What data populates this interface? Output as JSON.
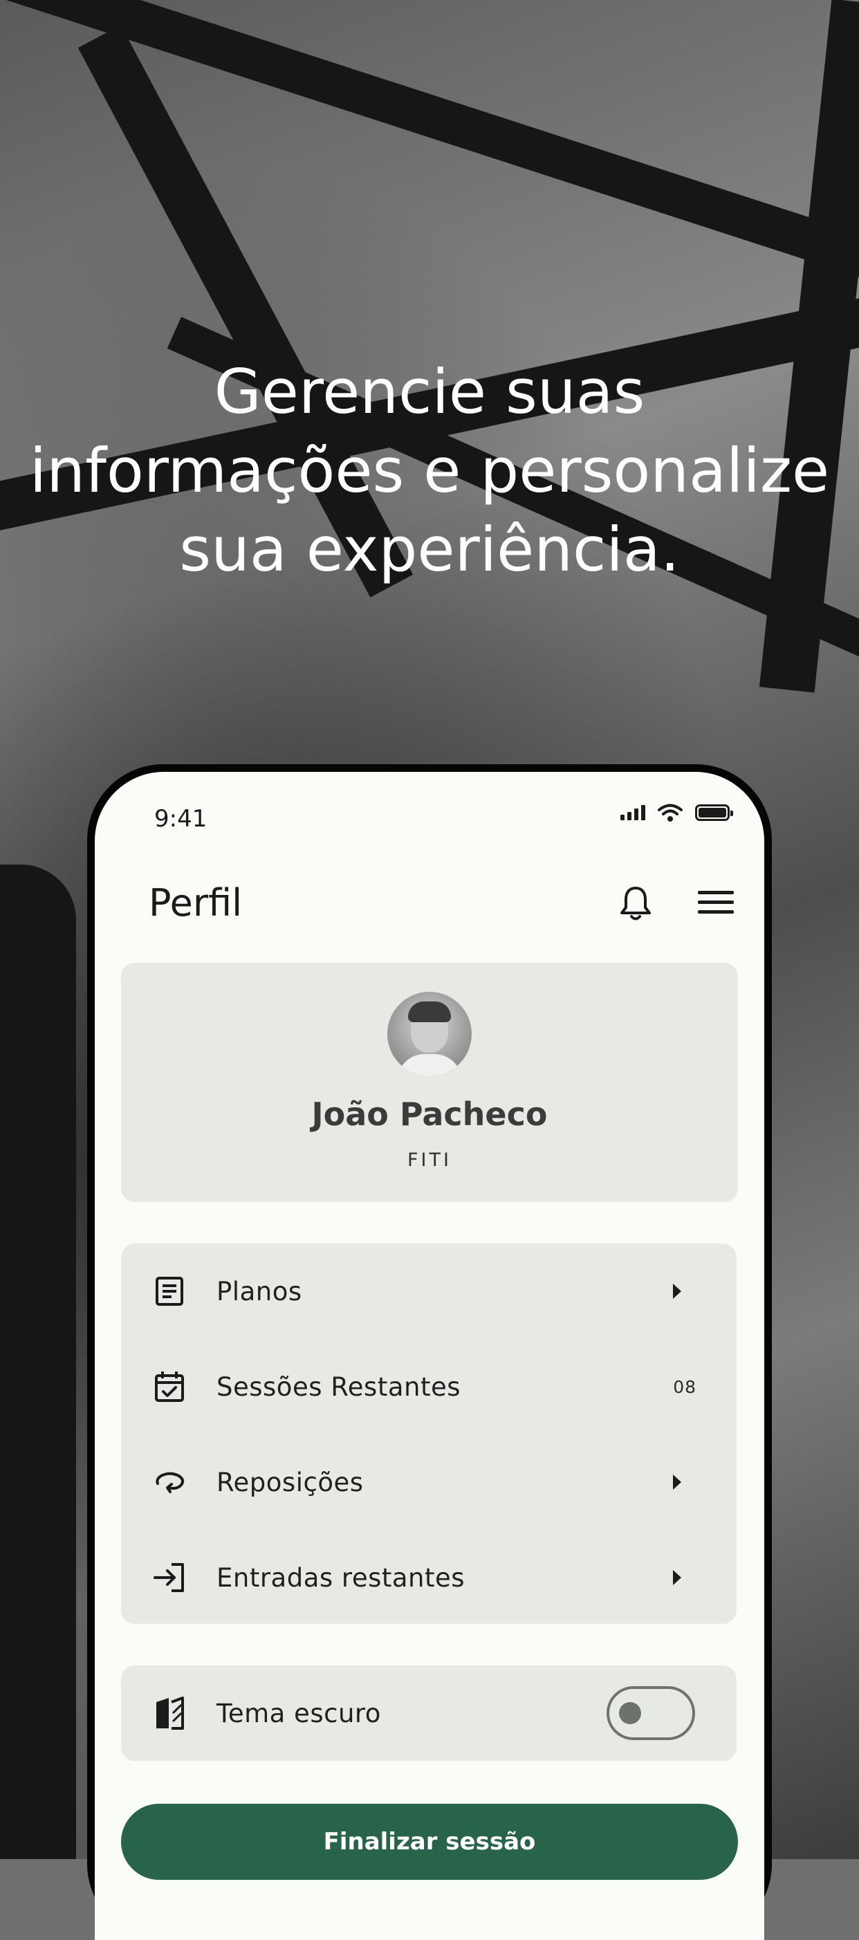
{
  "headline": {
    "line1": "Gerencie suas",
    "line2": "informações e personalize",
    "line3": "sua experiência."
  },
  "status_bar": {
    "time": "9:41"
  },
  "header": {
    "title": "Perfil"
  },
  "profile": {
    "name": "João Pacheco",
    "organization": "FITI"
  },
  "menu_items": [
    {
      "label": "Planos",
      "icon": "document-icon",
      "trailing": "chevron"
    },
    {
      "label": "Sessões Restantes",
      "icon": "calendar-check-icon",
      "trailing": "count",
      "count": "08"
    },
    {
      "label": "Reposições",
      "icon": "rotate-icon",
      "trailing": "chevron"
    },
    {
      "label": "Entradas restantes",
      "icon": "login-icon",
      "trailing": "chevron"
    }
  ],
  "theme": {
    "label": "Tema escuro",
    "enabled": false
  },
  "actions": {
    "logout_label": "Finalizar sessão"
  },
  "colors": {
    "primary": "#27644a",
    "surface": "#fafcf8",
    "card": "#e7e9e5"
  }
}
